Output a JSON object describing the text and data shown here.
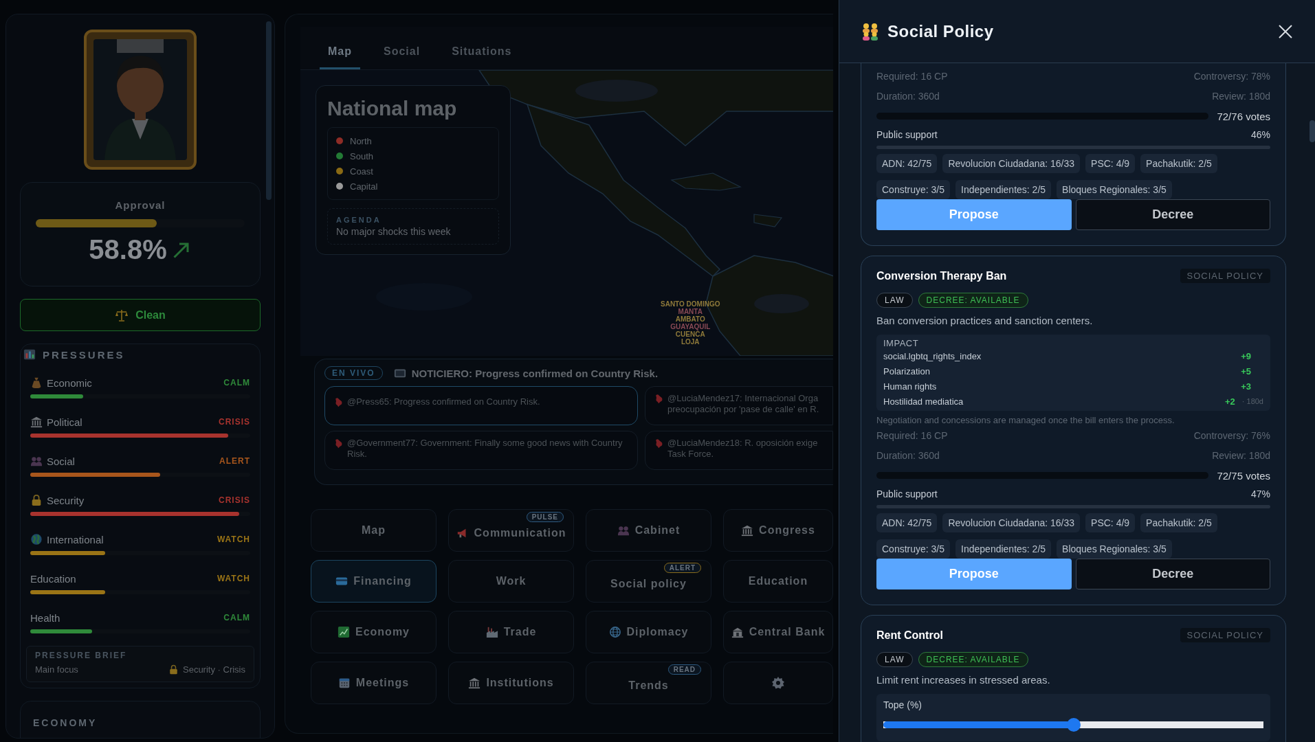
{
  "sidebar": {
    "approval": {
      "label": "Approval",
      "level": 0.58,
      "value": "58.8%"
    },
    "integrity_button": {
      "label": "Clean"
    },
    "pressures": {
      "title": "PRESSURES",
      "items": [
        {
          "name": "Economic",
          "status": "CALM",
          "color": "#2f8a3a",
          "level": 0.24
        },
        {
          "name": "Political",
          "status": "CRISIS",
          "color": "#a8332e",
          "level": 0.9
        },
        {
          "name": "Social",
          "status": "ALERT",
          "color": "#a8561c",
          "level": 0.59
        },
        {
          "name": "Security",
          "status": "CRISIS",
          "color": "#a8332e",
          "level": 0.95
        },
        {
          "name": "International",
          "status": "WATCH",
          "color": "#9a7416",
          "level": 0.34
        },
        {
          "name": "Education",
          "status": "WATCH",
          "color": "#9a7416",
          "level": 0.34
        },
        {
          "name": "Health",
          "status": "CALM",
          "color": "#2f8a3a",
          "level": 0.28
        }
      ],
      "brief": {
        "title": "PRESSURE BRIEF",
        "label": "Main focus",
        "value": "Security · Crisis"
      }
    },
    "economy": {
      "title": "ECONOMY"
    }
  },
  "main": {
    "tabs": [
      {
        "label": "Map",
        "selected": true
      },
      {
        "label": "Social",
        "selected": false
      },
      {
        "label": "Situations",
        "selected": false
      }
    ],
    "national_map": {
      "title": "National map",
      "legend": [
        {
          "label": "North",
          "color": "#8e2c26"
        },
        {
          "label": "South",
          "color": "#237a35"
        },
        {
          "label": "Coast",
          "color": "#8a6a14"
        },
        {
          "label": "Capital",
          "color": "#9a9a9a"
        }
      ],
      "agenda": {
        "title": "AGENDA",
        "text": "No major shocks this week"
      }
    },
    "cities": [
      {
        "name": "SANTO DOMINGO",
        "color": "#8f7a3a"
      },
      {
        "name": "MANTA",
        "color": "#8a4a55"
      },
      {
        "name": "AMBATO",
        "color": "#8f7a3a"
      },
      {
        "name": "GUAYAQUIL",
        "color": "#8a4a55"
      },
      {
        "name": "CUENCA",
        "color": "#8f7a3a"
      },
      {
        "name": "LOJA",
        "color": "#8f7a3a"
      }
    ],
    "news": {
      "badge": "EN VIVO",
      "headline": "NOTICIERO: Progress confirmed on Country Risk.",
      "posts": [
        {
          "lines": [
            "@Press65: Progress confirmed on Country Risk."
          ],
          "selected": true
        },
        {
          "lines": [
            "@LuciaMendez17: Internacional Orga",
            "preocupación por 'pase de calle' en R."
          ],
          "selected": false
        },
        {
          "lines": [
            "@Government77: Government: Finally some good news with Country Risk."
          ],
          "selected": false
        },
        {
          "lines": [
            "@LuciaMendez18: R. oposición exige",
            "Task Force."
          ],
          "selected": false
        }
      ]
    },
    "buttons": [
      {
        "label": "Map",
        "selected": false
      },
      {
        "label": "Communication",
        "selected": false,
        "badge": {
          "text": "PULSE",
          "color": "#2e5a80"
        }
      },
      {
        "label": "Cabinet",
        "selected": false
      },
      {
        "label": "Congress",
        "selected": false
      },
      {
        "label": "Financing",
        "selected": true
      },
      {
        "label": "Work",
        "selected": false
      },
      {
        "label": "Social policy",
        "selected": false,
        "badge": {
          "text": "ALERT",
          "color": "#8a6d1c"
        }
      },
      {
        "label": "Education",
        "selected": false
      },
      {
        "label": "Economy",
        "selected": false
      },
      {
        "label": "Trade",
        "selected": false
      },
      {
        "label": "Diplomacy",
        "selected": false
      },
      {
        "label": "Central Bank",
        "selected": false
      },
      {
        "label": "Meetings",
        "selected": false
      },
      {
        "label": "Institutions",
        "selected": false
      },
      {
        "label": "Trends",
        "selected": false,
        "badge": {
          "text": "READ",
          "color": "#2e5a80"
        }
      },
      {
        "selected": false
      }
    ]
  },
  "panel": {
    "title": "Social Policy",
    "cards": [
      {
        "required": "Required: 16 CP",
        "controversy": "Controversy: 78%",
        "duration": "Duration: 360d",
        "review": "Review: 180d",
        "votes": "72/76 votes",
        "support_label": "Public support",
        "support_value": "46%",
        "parties": [
          "ADN: 42/75",
          "Revolucion Ciudadana: 16/33",
          "PSC: 4/9",
          "Pachakutik: 2/5",
          "Construye: 3/5",
          "Independientes: 2/5",
          "Bloques Regionales: 3/5"
        ],
        "actions": [
          "Propose",
          "Decree"
        ]
      },
      {
        "title": "Conversion Therapy Ban",
        "category": "SOCIAL POLICY",
        "tags": [
          {
            "text": "LAW",
            "kind": "type"
          },
          {
            "text": "DECREE: AVAILABLE",
            "kind": "status"
          }
        ],
        "description": "Ban conversion practices and sanction centers.",
        "impact": {
          "title": "IMPACT",
          "rows": [
            {
              "name": "social.lgbtq_rights_index",
              "value": "+9"
            },
            {
              "name": "Polarization",
              "value": "+5"
            },
            {
              "name": "Human rights",
              "value": "+3"
            },
            {
              "name": "Hostilidad mediatica",
              "value": "+2",
              "note": "· 180d"
            }
          ]
        },
        "note": "Negotiation and concessions are managed once the bill enters the process.",
        "required": "Required: 16 CP",
        "controversy": "Controversy: 76%",
        "duration": "Duration: 360d",
        "review": "Review: 180d",
        "votes": "72/75 votes",
        "support_label": "Public support",
        "support_value": "47%",
        "parties": [
          "ADN: 42/75",
          "Revolucion Ciudadana: 16/33",
          "PSC: 4/9",
          "Pachakutik: 2/5",
          "Construye: 3/5",
          "Independientes: 2/5",
          "Bloques Regionales: 3/5"
        ],
        "actions": [
          "Propose",
          "Decree"
        ]
      },
      {
        "title": "Rent Control",
        "category": "SOCIAL POLICY",
        "tags": [
          {
            "text": "LAW",
            "kind": "type"
          },
          {
            "text": "DECREE: AVAILABLE",
            "kind": "status"
          }
        ],
        "description": "Limit rent increases in stressed areas.",
        "parameter": {
          "label": "Tope (%)",
          "level": 0.5
        }
      }
    ]
  }
}
